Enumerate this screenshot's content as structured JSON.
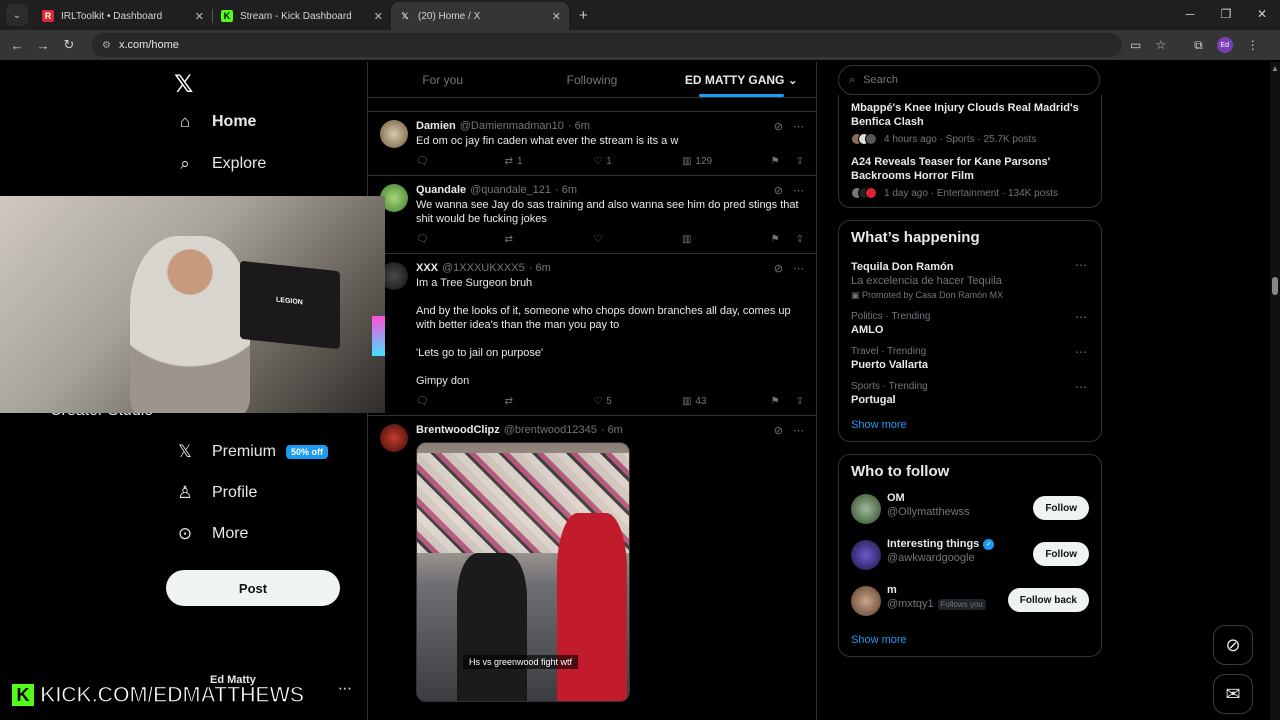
{
  "browser": {
    "tabs": [
      {
        "label": "IRLToolkit • Dashboard",
        "favicon": "irltoolkit-icon",
        "color": "#e0263b"
      },
      {
        "label": "Stream - Kick Dashboard",
        "favicon": "kick-icon",
        "color": "#53fc18"
      },
      {
        "label": "(20) Home / X",
        "favicon": "x-icon",
        "color": "#ffffff"
      }
    ],
    "url": "x.com/home",
    "profile": "Ed"
  },
  "nav": {
    "home": "Home",
    "explore": "Explore",
    "creator_studio": "Creator Studio",
    "premium": "Premium",
    "premium_badge": "50% off",
    "profile": "Profile",
    "more": "More",
    "post": "Post",
    "account_name": "Ed Matty"
  },
  "timeline": {
    "tabs": [
      "For you",
      "Following",
      "ED MATTY GANG"
    ],
    "tweets": [
      {
        "name": "Damien",
        "handle": "@Damienmadman10",
        "time": "· 6m",
        "text": "Ed om oc jay fin caden what ever the stream is its a w",
        "reposts": "1",
        "likes": "1",
        "views": "129"
      },
      {
        "name": "Quandale",
        "handle": "@quandale_121",
        "time": "· 6m",
        "text": "We wanna see Jay do sas training and also wanna see him do pred stings that shit would be fucking jokes",
        "reposts": "",
        "likes": "",
        "views": ""
      },
      {
        "name": "XXX",
        "handle": "@1XXXUKXXX5",
        "time": "· 6m",
        "text": "Im a Tree Surgeon bruh\n\nAnd by the looks of it, someone who chops down branches all day, comes up with better idea's than the man you pay to\n\n'Lets go to jail on purpose'\n\nGimpy don",
        "reposts": "",
        "likes": "5",
        "views": "43"
      },
      {
        "name": "BrentwoodClipz",
        "handle": "@brentwood12345",
        "time": "· 6m",
        "text": "",
        "media_caption": "Hs vs greenwood fight wtf"
      }
    ]
  },
  "sidebar": {
    "search_placeholder": "Search",
    "news": [
      {
        "title": "Mbappé's Knee Injury Clouds Real Madrid's Benfica Clash",
        "meta": "4 hours ago · Sports · 25.7K posts"
      },
      {
        "title": "A24 Reveals Teaser for Kane Parsons' Backrooms Horror Film",
        "meta": "1 day ago · Entertainment · 134K posts"
      }
    ],
    "happening_title": "What’s happening",
    "trends": [
      {
        "context": "",
        "name": "Tequila Don Ramón",
        "sub": "La excelencia de hacer Tequila",
        "promo": "Promoted by Casa Don Ramón MX"
      },
      {
        "context": "Politics · Trending",
        "name": "AMLO"
      },
      {
        "context": "Travel · Trending",
        "name": "Puerto Vallarta"
      },
      {
        "context": "Sports · Trending",
        "name": "Portugal"
      }
    ],
    "show_more": "Show more",
    "wtf_title": "Who to follow",
    "who_to_follow": [
      {
        "name": "OM",
        "handle": "@Ollymatthewss",
        "button": "Follow"
      },
      {
        "name": "Interesting things",
        "handle": "@awkwardgoogle",
        "button": "Follow",
        "verified": true
      },
      {
        "name": "m",
        "handle": "@mxtqy1",
        "button": "Follow back",
        "follows_you": "Follows you"
      }
    ],
    "wtf_show_more": "Show more"
  },
  "overlay": {
    "kick_url": "KICK.COM/EDMATTHEWS",
    "kick_letter": "K",
    "laptop_brand": "LEGION"
  },
  "colors": {
    "accent": "#1d9bf0",
    "kick": "#53fc18"
  }
}
